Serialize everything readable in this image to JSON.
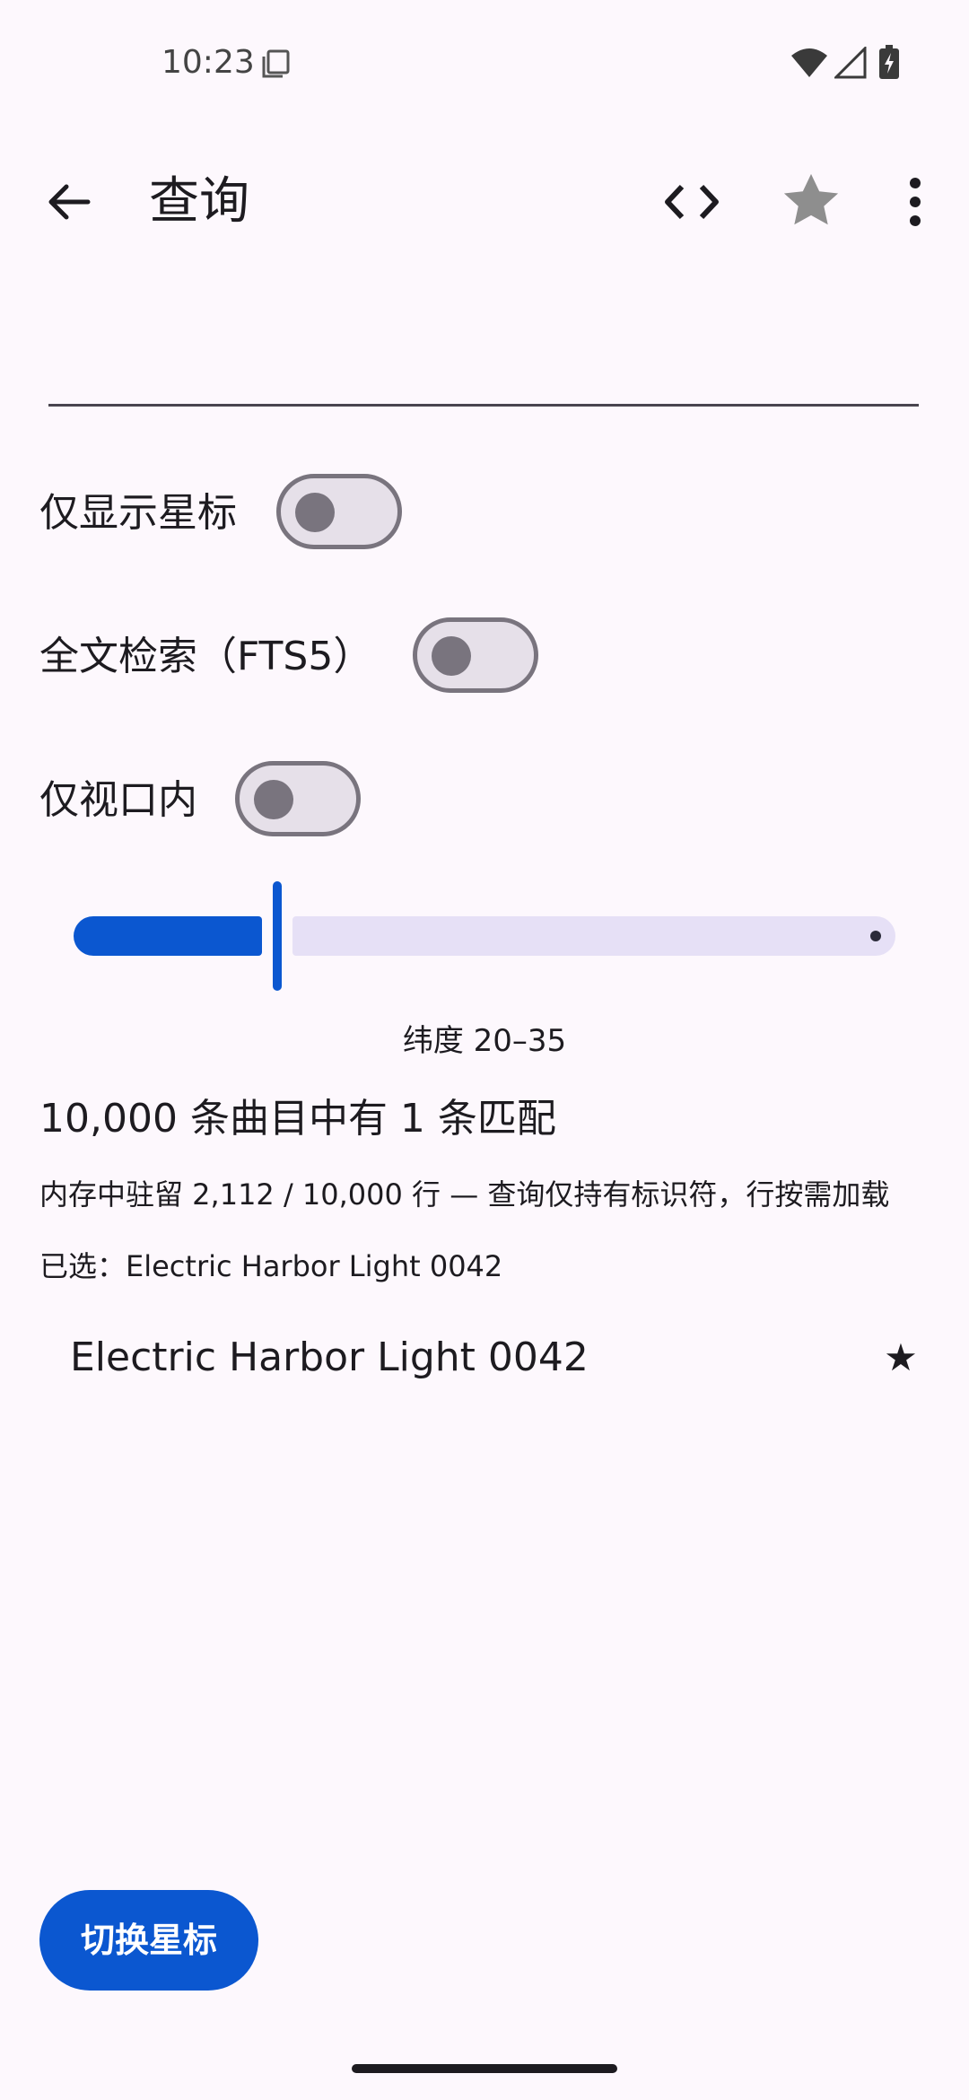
{
  "status_bar": {
    "time": "10:23",
    "icons": [
      "sim-card-icon",
      "wifi-icon",
      "cellular-signal-icon",
      "battery-charging-icon"
    ]
  },
  "app_bar": {
    "title": "查询",
    "icons": [
      "back-arrow-icon",
      "code-icon",
      "star-icon",
      "more-vert-icon"
    ]
  },
  "search": {
    "value": "",
    "placeholder": ""
  },
  "toggles": [
    {
      "label": "仅显示星标",
      "checked": false
    },
    {
      "label": "全文检索（FTS5）",
      "checked": false
    },
    {
      "label": "仅视口内",
      "checked": false
    }
  ],
  "slider": {
    "caption": "纬度 20–35",
    "value": 0.24
  },
  "results": {
    "match_count": "10,000 条曲目中有 1 条匹配",
    "memory_note": "内存中驻留 2,112 / 10,000 行 — 查询仅持有标识符，行按需加载",
    "selected": "已选：Electric Harbor Light 0042",
    "items": [
      {
        "title": "Electric Harbor Light 0042",
        "star": "★"
      }
    ]
  },
  "fab": {
    "label": "切换星标"
  },
  "colors": {
    "accent": "#0b57d0",
    "background": "#fdf8fd",
    "slider_track": "#e6e0f6",
    "switch_outline": "#79747e"
  }
}
